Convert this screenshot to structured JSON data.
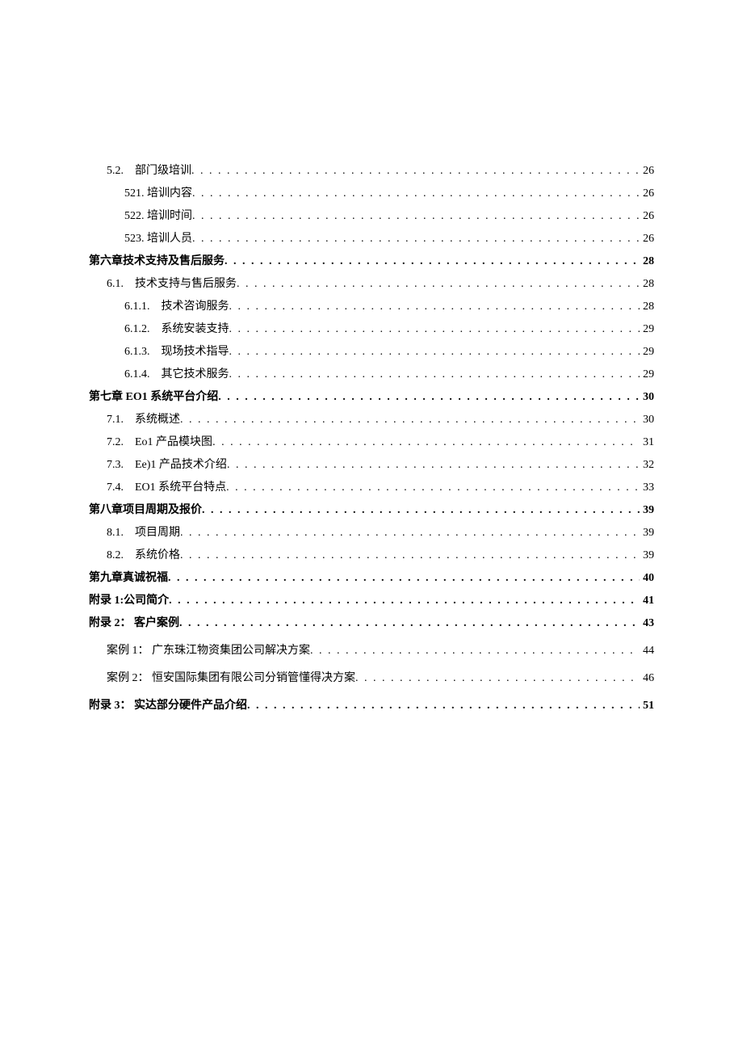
{
  "toc": [
    {
      "label": "5.2.　部门级培训 ",
      "page": "26",
      "indent": 1,
      "bold": false
    },
    {
      "label": "521. 培训内容 ",
      "page": "26",
      "indent": 2,
      "bold": false
    },
    {
      "label": "522. 培训时间 ",
      "page": "26",
      "indent": 2,
      "bold": false
    },
    {
      "label": "523. 培训人员 ",
      "page": "26",
      "indent": 2,
      "bold": false
    },
    {
      "label": "第六章技术支持及售后服务",
      "page": "28",
      "indent": 0,
      "bold": true
    },
    {
      "label": "6.1.　技术支持与售后服务 ",
      "page": "28",
      "indent": 1,
      "bold": false
    },
    {
      "label": "6.1.1.　技术咨询服务",
      "page": "28",
      "indent": 2,
      "bold": false
    },
    {
      "label": "6.1.2.　系统安装支持",
      "page": "29",
      "indent": 2,
      "bold": false
    },
    {
      "label": "6.1.3.　现场技术指导",
      "page": "29",
      "indent": 2,
      "bold": false
    },
    {
      "label": "6.1.4.　其它技术服务",
      "page": "29",
      "indent": 2,
      "bold": false
    },
    {
      "label": "第七章 EO1 系统平台介绍",
      "page": "30",
      "indent": 0,
      "bold": true
    },
    {
      "label": "7.1.　系统概述 ",
      "page": "30",
      "indent": 1,
      "bold": false
    },
    {
      "label": "7.2.　Eo1 产品模块图 ",
      "page": "31",
      "indent": 1,
      "bold": false
    },
    {
      "label": "7.3.　Ee)1 产品技术介绍",
      "page": "32",
      "indent": 1,
      "bold": false
    },
    {
      "label": "7.4.　EO1 系统平台特点",
      "page": "33",
      "indent": 1,
      "bold": false
    },
    {
      "label": "第八章项目周期及报价",
      "page": "39",
      "indent": 0,
      "bold": true
    },
    {
      "label": "8.1.　项目周期 ",
      "page": "39",
      "indent": 1,
      "bold": false
    },
    {
      "label": "8.2.　系统价格 ",
      "page": "39",
      "indent": 1,
      "bold": false
    },
    {
      "label": "第九章真诚祝福",
      "page": "40",
      "indent": 0,
      "bold": true
    },
    {
      "label": "附录 1:公司简介 ",
      "page": "41",
      "indent": 0,
      "bold": true
    },
    {
      "label": "附录 2： 客户案例 ",
      "page": "43",
      "indent": 0,
      "bold": true,
      "gap": true
    },
    {
      "label": "案例 1： 广东珠江物资集团公司解决方案",
      "page": "44",
      "indent": 1,
      "bold": false,
      "gap": true
    },
    {
      "label": "案例 2： 恒安国际集团有限公司分销管懂得决方案",
      "page": "46",
      "indent": 1,
      "bold": false,
      "gap": true
    },
    {
      "label": "附录 3： 实达部分硬件产品介绍",
      "page": "51",
      "indent": 0,
      "bold": true
    }
  ]
}
